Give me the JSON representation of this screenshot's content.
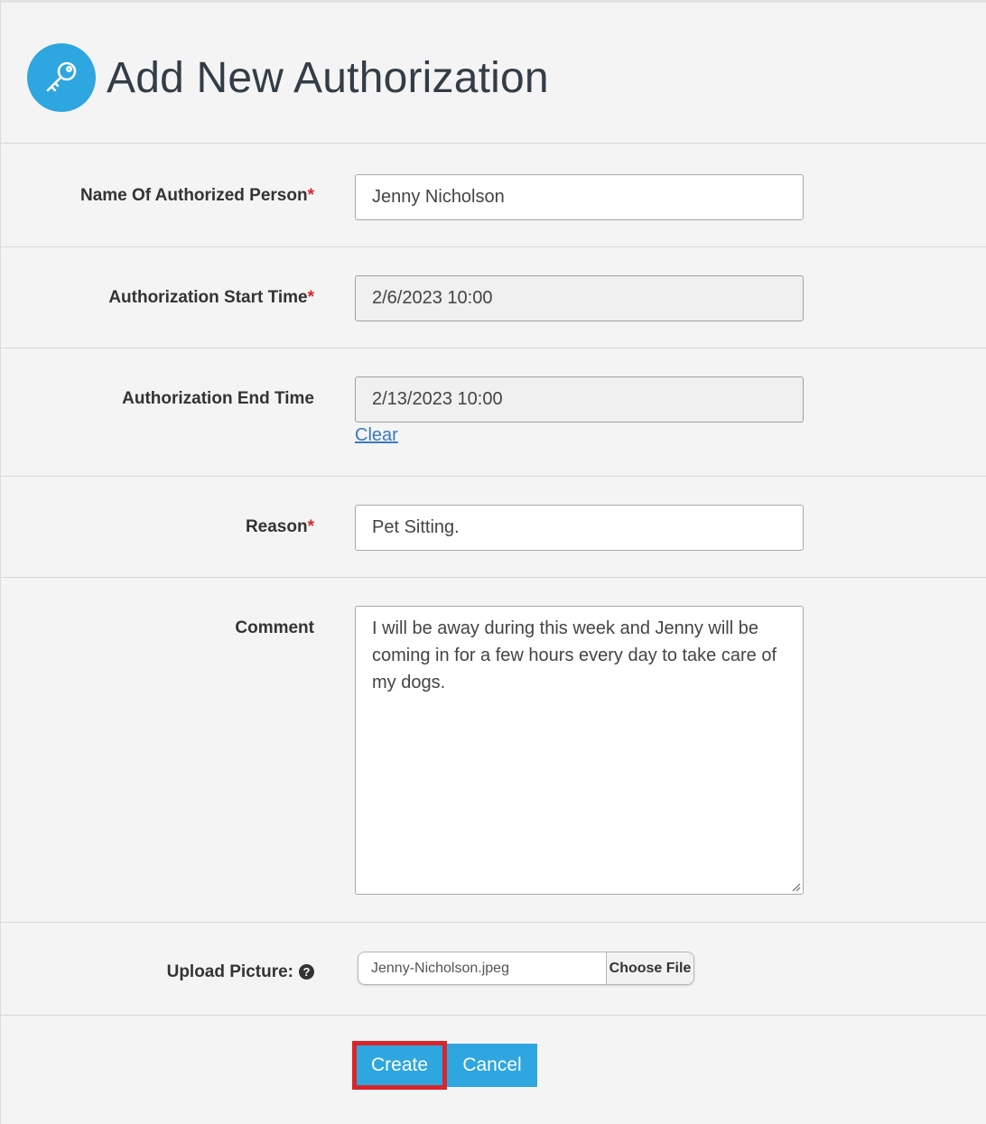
{
  "header": {
    "title": "Add New Authorization",
    "icon": "key-icon",
    "accent_color": "#2ea6df"
  },
  "form": {
    "name": {
      "label": "Name Of Authorized Person",
      "required_mark": "*",
      "value": "Jenny Nicholson"
    },
    "start_time": {
      "label": "Authorization Start Time",
      "required_mark": "*",
      "value": "2/6/2023 10:00"
    },
    "end_time": {
      "label": "Authorization End Time",
      "value": "2/13/2023 10:00",
      "clear_label": "Clear"
    },
    "reason": {
      "label": "Reason",
      "required_mark": "*",
      "value": "Pet Sitting."
    },
    "comment": {
      "label": "Comment",
      "value": "I will be away during this week and Jenny will be coming in for a few hours every day to take care of my dogs."
    },
    "upload": {
      "label": "Upload Picture:",
      "help_icon": "question-circle-icon",
      "file_name": "Jenny-Nicholson.jpeg",
      "button_label": "Choose File"
    }
  },
  "actions": {
    "create_label": "Create",
    "cancel_label": "Cancel",
    "highlight_color": "#d9252b"
  }
}
